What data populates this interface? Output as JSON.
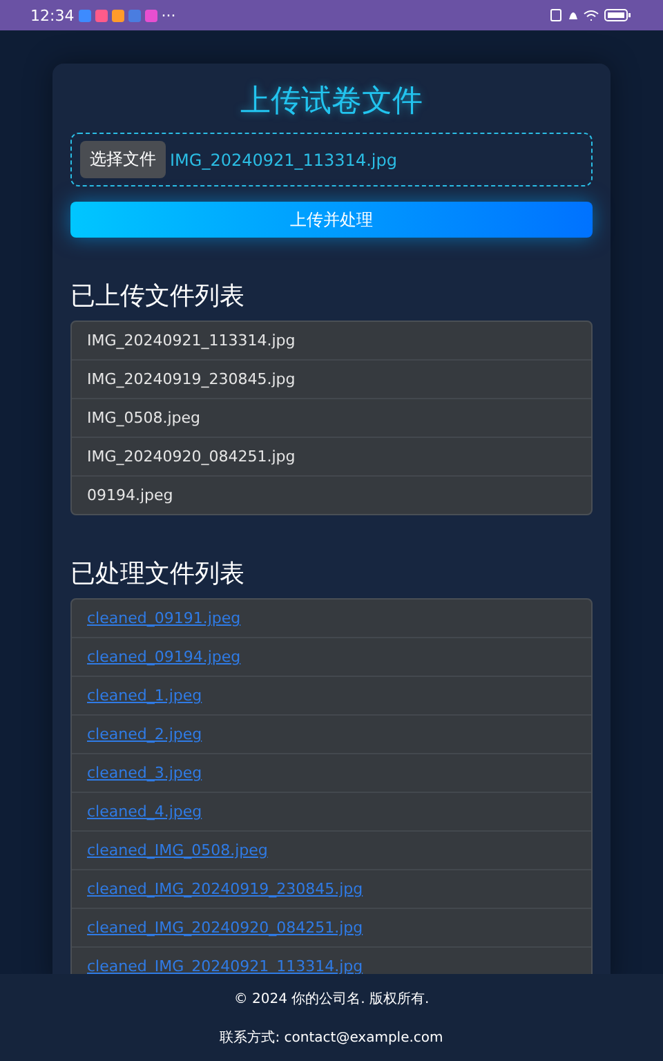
{
  "status_bar": {
    "time": "12:34",
    "more": "···"
  },
  "title": "上传试卷文件",
  "file_picker": {
    "button": "选择文件",
    "file_name": "IMG_20240921_113314.jpg"
  },
  "upload_button": "上传并处理",
  "uploaded": {
    "heading": "已上传文件列表",
    "files": [
      "IMG_20240921_113314.jpg",
      "IMG_20240919_230845.jpg",
      "IMG_0508.jpeg",
      "IMG_20240920_084251.jpg",
      "09194.jpeg"
    ]
  },
  "processed": {
    "heading": "已处理文件列表",
    "files": [
      "cleaned_09191.jpeg",
      "cleaned_09194.jpeg",
      "cleaned_1.jpeg",
      "cleaned_2.jpeg",
      "cleaned_3.jpeg",
      "cleaned_4.jpeg",
      "cleaned_IMG_0508.jpeg",
      "cleaned_IMG_20240919_230845.jpg",
      "cleaned_IMG_20240920_084251.jpg",
      "cleaned_IMG_20240921_113314.jpg"
    ]
  },
  "footer": {
    "copyright": "© 2024 你的公司名. 版权所有.",
    "contact": "联系方式: contact@example.com"
  }
}
